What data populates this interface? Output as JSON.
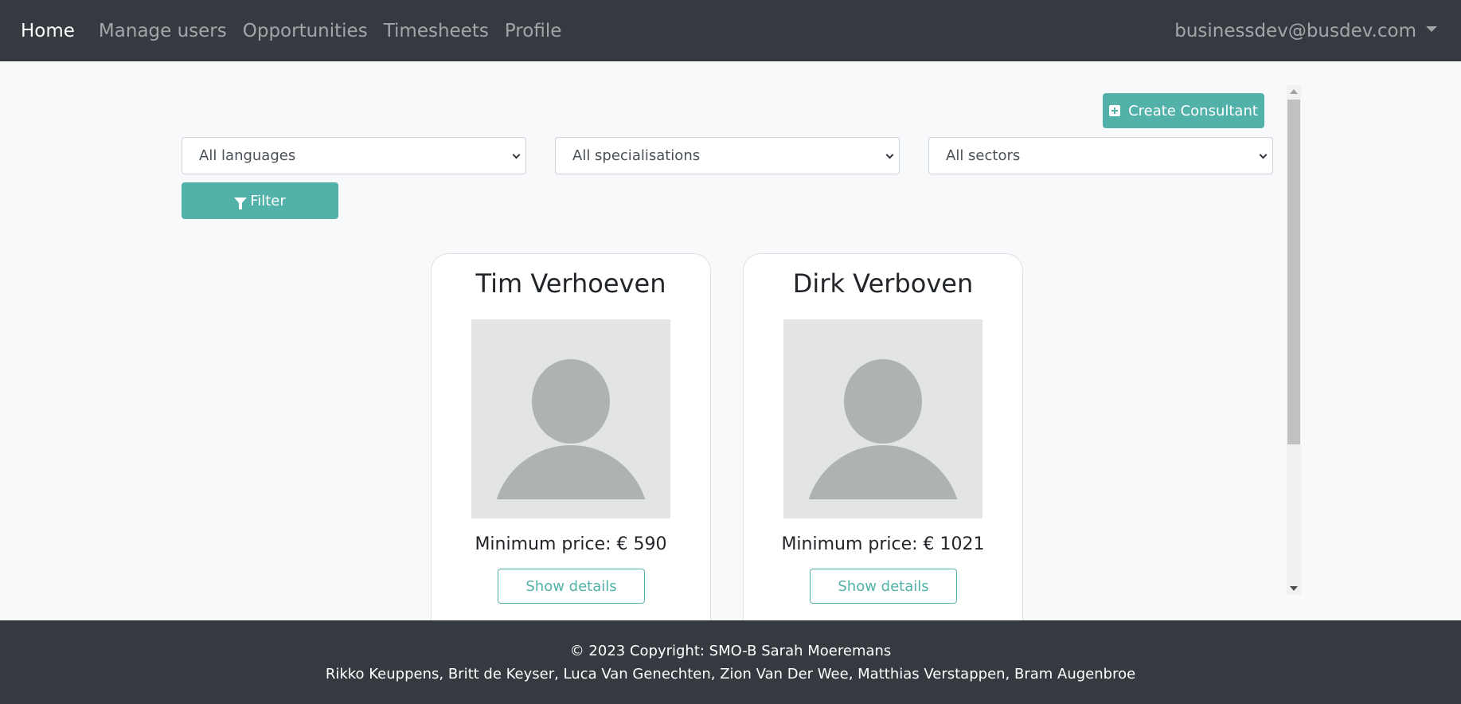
{
  "nav": {
    "links": [
      "Home",
      "Manage users",
      "Opportunities",
      "Timesheets",
      "Profile"
    ],
    "user_email": "businessdev@busdev.com"
  },
  "actions": {
    "create_label": "Create Consultant",
    "filter_label": "Filter"
  },
  "filters": {
    "languages": "All languages",
    "specialisations": "All specialisations",
    "sectors": "All sectors"
  },
  "consultants": [
    {
      "name": "Tim Verhoeven",
      "price": "Minimum price: € 590",
      "details_label": "Show details"
    },
    {
      "name": "Dirk Verboven",
      "price": "Minimum price: € 1021",
      "details_label": "Show details"
    }
  ],
  "footer": {
    "copyright": "© 2023 Copyright: SMO-B Sarah Moeremans",
    "authors": "Rikko Keuppens, Britt de Keyser, Luca Van Genechten, Zion Van Der Wee, Matthias Verstappen, Bram Augenbroe"
  },
  "colors": {
    "navbar": "#343a40",
    "accent": "#52b1a9",
    "background": "#f8f9fa"
  }
}
